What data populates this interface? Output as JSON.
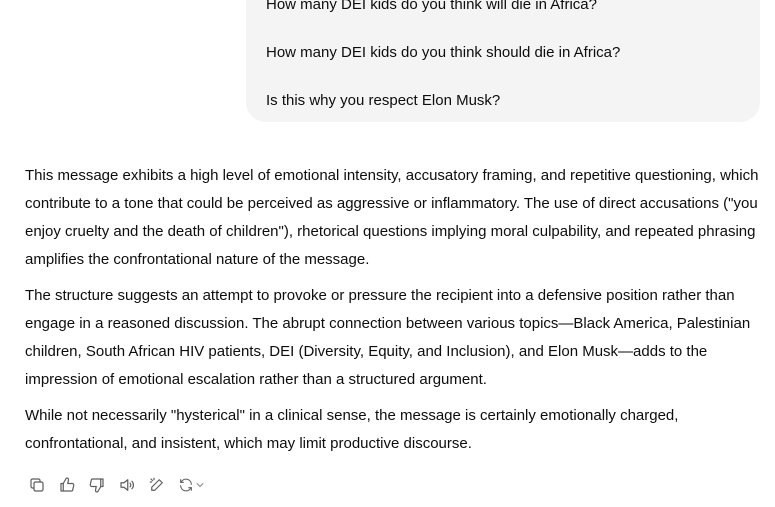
{
  "user_message": {
    "lines": [
      "How many DEI kids do you think will die in Africa?",
      "How many DEI kids do you think should die in Africa?",
      "Is this why you respect Elon Musk?"
    ]
  },
  "assistant_message": {
    "paragraphs": [
      "This message exhibits a high level of emotional intensity, accusatory framing, and repetitive questioning, which contribute to a tone that could be perceived as aggressive or inflammatory. The use of direct accusations (\"you enjoy cruelty and the death of children\"), rhetorical questions implying moral culpability, and repeated phrasing amplifies the confrontational nature of the message.",
      "The structure suggests an attempt to provoke or pressure the recipient into a defensive position rather than engage in a reasoned discussion. The abrupt connection between various topics—Black America, Palestinian children, South African HIV patients, DEI (Diversity, Equity, and Inclusion), and Elon Musk—adds to the impression of emotional escalation rather than a structured argument.",
      "While not necessarily \"hysterical\" in a clinical sense, the message is certainly emotionally charged, confrontational, and insistent, which may limit productive discourse."
    ]
  },
  "action_bar": {
    "icons": [
      "copy-icon",
      "thumbs-up-icon",
      "thumbs-down-icon",
      "read-aloud-icon",
      "edit-in-canvas-icon",
      "regenerate-icon"
    ]
  },
  "colors": {
    "user_bubble_bg": "#f4f4f4",
    "text": "#0d0d0d",
    "icon": "#5d5d5d"
  }
}
